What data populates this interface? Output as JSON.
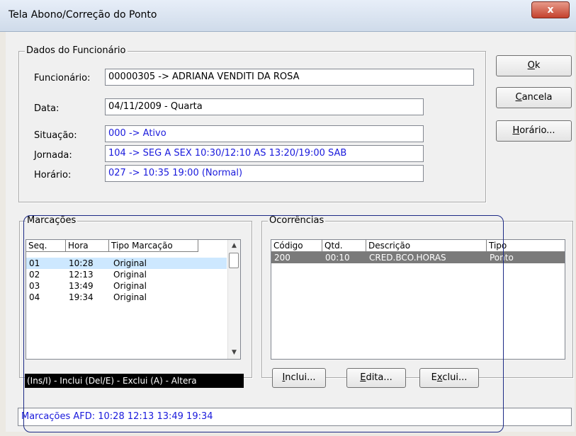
{
  "window": {
    "title": "Tela Abono/Correção do Ponto",
    "close_glyph": "x"
  },
  "employee": {
    "legend": "Dados do Funcionário",
    "labels": {
      "funcionario": "Funcionário:",
      "data": "Data:",
      "situacao": "Situação:",
      "jornada": "Jornada:",
      "horario": "Horário:"
    },
    "values": {
      "funcionario": "00000305 -> ADRIANA VENDITI DA ROSA",
      "data": "04/11/2009 - Quarta",
      "situacao": "000 -> Ativo",
      "jornada": "104 -> SEG A SEX 10:30/12:10 AS 13:20/19:00 SAB",
      "horario": "027 -> 10:35 19:00  (Normal)"
    },
    "value_color": "#1a1adc"
  },
  "buttons": {
    "ok": {
      "mn": "O",
      "rest": "k"
    },
    "cancela": {
      "mn": "C",
      "rest": "ancela"
    },
    "horario": {
      "mn": "H",
      "rest": "orário..."
    }
  },
  "marcacoes": {
    "legend": "Marcações",
    "headers": [
      "Seq.",
      "Hora",
      "Tipo Marcação"
    ],
    "rows": [
      [
        "01",
        "10:28",
        "Original"
      ],
      [
        "02",
        "12:13",
        "Original"
      ],
      [
        "03",
        "13:49",
        "Original"
      ],
      [
        "04",
        "19:34",
        "Original"
      ]
    ],
    "footer": "(Ins/I) - Inclui    (Del/E) - Exclui    (A) - Altera"
  },
  "ocorrencias": {
    "legend": "Ocorrências",
    "headers": [
      "Código",
      "Qtd.",
      "Descrição",
      "Tipo"
    ],
    "rows": [
      [
        "200",
        "00:10",
        "CRED.BCO.HORAS",
        "Ponto"
      ]
    ],
    "buttons": {
      "inclui": {
        "mn": "I",
        "rest": "nclui..."
      },
      "edita": {
        "mn": "E",
        "rest": "dita..."
      },
      "exclui": {
        "pre": "E",
        "mn": "x",
        "rest": "clui..."
      }
    }
  },
  "afd": "Marcações AFD: 10:28 12:13 13:49 19:34"
}
